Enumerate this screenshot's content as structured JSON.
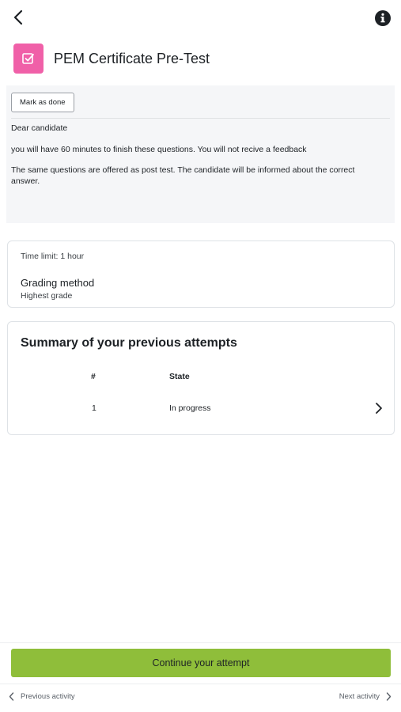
{
  "header": {
    "title": "PEM Certificate Pre-Test",
    "icon": "quiz-checkbox-icon",
    "icon_color": "#f060a8"
  },
  "intro": {
    "mark_done_label": "Mark as done",
    "paragraphs": [
      "Dear candidate",
      "you will have 60 minutes to finish these questions. You will not recive a feedback",
      "The same questions are offered as post test. The candidate will be informed about the correct answer."
    ]
  },
  "info": {
    "time_limit": "Time limit: 1 hour",
    "grading_label": "Grading method",
    "grading_value": "Highest grade"
  },
  "summary": {
    "title": "Summary of your previous attempts",
    "columns": [
      "#",
      "State"
    ],
    "rows": [
      {
        "num": "1",
        "state": "In progress"
      }
    ]
  },
  "actions": {
    "continue_label": "Continue your attempt",
    "continue_color": "#8fbe3a"
  },
  "footer": {
    "previous": "Previous activity",
    "next": "Next activity"
  }
}
